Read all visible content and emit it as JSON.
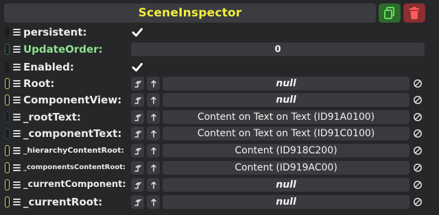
{
  "header": {
    "title": "SceneInspector"
  },
  "rows": [
    {
      "name": "persistent",
      "label": "persistent:",
      "kind": "bool",
      "checked": true,
      "handle_color": "#222324"
    },
    {
      "name": "update-order",
      "label": "UpdateOrder:",
      "kind": "number",
      "value": "0",
      "handle_color": "#2d7a33",
      "label_color": "#8fe08f"
    },
    {
      "name": "enabled",
      "label": "Enabled:",
      "kind": "bool",
      "checked": true,
      "handle_color": "#222324"
    },
    {
      "name": "root",
      "label": "Root:",
      "kind": "ref",
      "value": "null",
      "is_null": true,
      "handle_color": "#c9d46a"
    },
    {
      "name": "component-view",
      "label": "ComponentView:",
      "kind": "ref",
      "value": "null",
      "is_null": true,
      "handle_color": "#c9d46a"
    },
    {
      "name": "root-text",
      "label": "_rootText:",
      "kind": "ref",
      "value": "Content on Text on Text (ID91A0100)",
      "is_null": false,
      "handle_color": "#2b3f73"
    },
    {
      "name": "component-text",
      "label": "_componentText:",
      "kind": "ref",
      "value": "Content on Text on Text (ID91C0100)",
      "is_null": false,
      "handle_color": "#2b3f73"
    },
    {
      "name": "hierarchy-content-root",
      "label": "_hierarchyContentRoot:",
      "kind": "ref",
      "value": "Content (ID918C200)",
      "is_null": false,
      "handle_color": "#c9d46a"
    },
    {
      "name": "components-content-root",
      "label": "_componentsContentRoot:",
      "kind": "ref",
      "value": "Content (ID919AC00)",
      "is_null": false,
      "handle_color": "#c9d46a"
    },
    {
      "name": "current-component",
      "label": "_currentComponent:",
      "kind": "ref",
      "value": "null",
      "is_null": true,
      "handle_color": "#c9d46a"
    },
    {
      "name": "current-root",
      "label": "_currentRoot:",
      "kind": "ref",
      "value": "null",
      "is_null": true,
      "handle_color": "#c9d46a"
    }
  ],
  "colors": {
    "title": "#f2ef3c",
    "copy_button": "#2f6a2c",
    "delete_button": "#8b2f31",
    "field_bg": "#3a3b3e"
  },
  "icons": {
    "copy": "copy-icon",
    "delete": "trash-icon",
    "jump": "jump-to-icon",
    "up": "arrow-up-icon",
    "clear": "clear-null-icon",
    "drag": "drag-handle-icon",
    "check": "checkmark-icon"
  }
}
